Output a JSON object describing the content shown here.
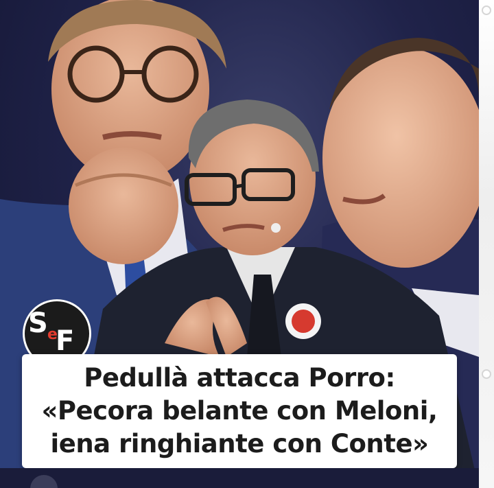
{
  "image": {
    "logo_text": "SeF",
    "headline": {
      "line1": "Pedullà attacca Porro:",
      "line2": "«Pecora belante con Meloni,",
      "line3": "iena ringhiante con Conte»"
    }
  },
  "colors": {
    "background": "#20234a",
    "caption_bg": "#ffffff",
    "caption_text": "#1c1c1c",
    "logo_red": "#e23b2e",
    "logo_white": "#ffffff"
  }
}
